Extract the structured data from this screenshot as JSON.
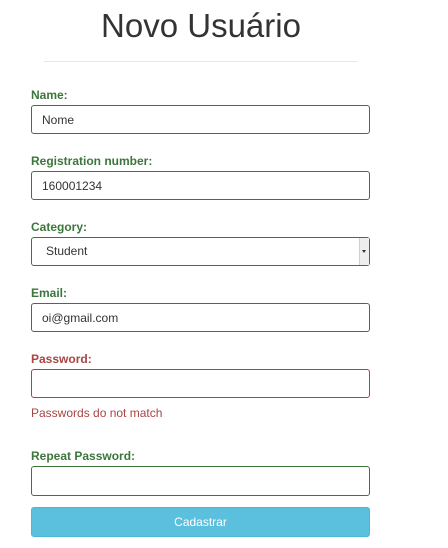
{
  "page": {
    "title": "Novo Usuário"
  },
  "form": {
    "name": {
      "label": "Name:",
      "value": "Nome"
    },
    "registration": {
      "label": "Registration number:",
      "value": "160001234"
    },
    "category": {
      "label": "Category:",
      "selected": "Student"
    },
    "email": {
      "label": "Email:",
      "value": "oi@gmail.com"
    },
    "password": {
      "label": "Password:",
      "value": "",
      "error": "Passwords do not match"
    },
    "repeat_password": {
      "label": "Repeat Password:",
      "value": ""
    },
    "submit_label": "Cadastrar"
  },
  "colors": {
    "success": "#3c763d",
    "error": "#a94442",
    "info_button": "#5bc0de"
  }
}
